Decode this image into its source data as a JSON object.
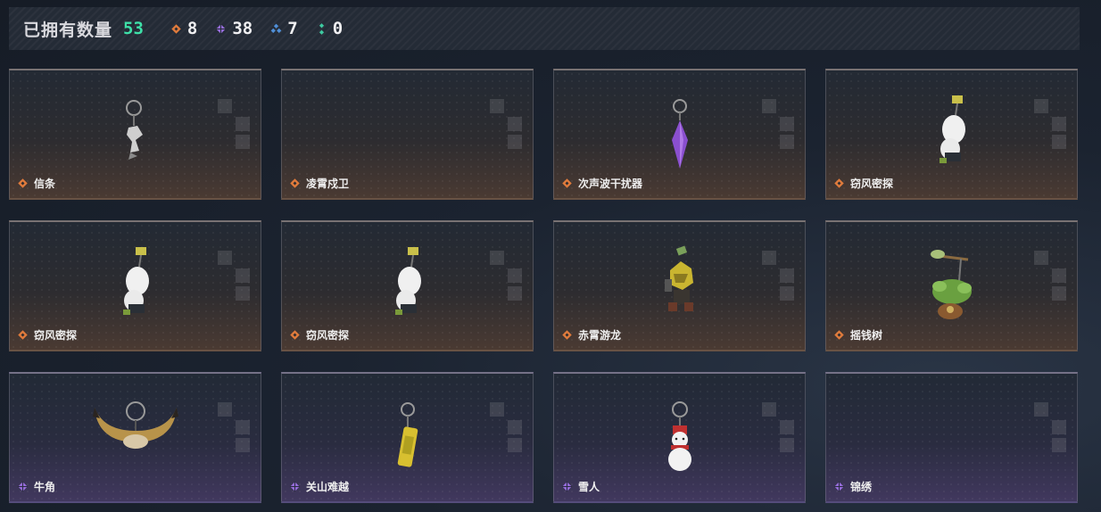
{
  "header": {
    "title": "已拥有数量",
    "total": "53",
    "stats": [
      {
        "icon": "orange-gem-icon",
        "color": "#e07b3c",
        "count": "8"
      },
      {
        "icon": "purple-gem-icon",
        "color": "#9a6fe0",
        "count": "38"
      },
      {
        "icon": "blue-gem-icon",
        "color": "#4f8fd8",
        "count": "7"
      },
      {
        "icon": "green-gem-icon",
        "color": "#3ec9a0",
        "count": "0"
      }
    ]
  },
  "cards": [
    {
      "name": "信条",
      "rarity": "orange",
      "icon": "white-figure-charm-icon"
    },
    {
      "name": "凌霄戍卫",
      "rarity": "orange",
      "icon": ""
    },
    {
      "name": "次声波干扰器",
      "rarity": "orange",
      "icon": "purple-crystal-charm-icon"
    },
    {
      "name": "窃风密探",
      "rarity": "orange",
      "icon": "white-rabbit-charm-icon"
    },
    {
      "name": "窃风密探",
      "rarity": "orange",
      "icon": "white-rabbit-charm-icon"
    },
    {
      "name": "窃风密探",
      "rarity": "orange",
      "icon": "white-rabbit-charm-icon"
    },
    {
      "name": "赤霄游龙",
      "rarity": "orange",
      "icon": "dragon-figure-charm-icon"
    },
    {
      "name": "摇钱树",
      "rarity": "orange",
      "icon": "money-tree-charm-icon"
    },
    {
      "name": "牛角",
      "rarity": "purple",
      "icon": "bull-horn-charm-icon"
    },
    {
      "name": "关山难越",
      "rarity": "purple",
      "icon": "yellow-can-charm-icon"
    },
    {
      "name": "雪人",
      "rarity": "purple",
      "icon": "snowman-charm-icon"
    },
    {
      "name": "锦绣",
      "rarity": "purple",
      "icon": ""
    }
  ]
}
